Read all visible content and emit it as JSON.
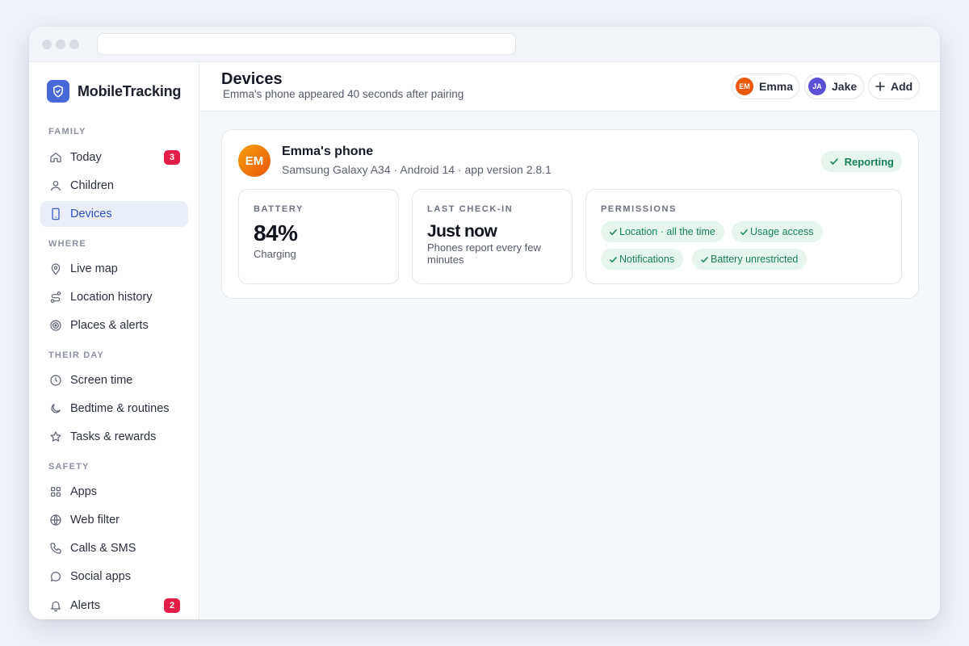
{
  "app": {
    "name": "MobileTracking",
    "accent": "#4668d9"
  },
  "sidebar": {
    "sections": [
      {
        "label": "FAMILY"
      },
      {
        "label": "WHERE"
      },
      {
        "label": "THEIR DAY"
      },
      {
        "label": "SAFETY"
      }
    ],
    "items": [
      {
        "label": "Today",
        "icon": "home-icon",
        "badge": "3"
      },
      {
        "label": "Children",
        "icon": "user-icon"
      },
      {
        "label": "Devices",
        "icon": "phone-icon",
        "active": true
      },
      {
        "label": "Live map",
        "icon": "map-pin-icon"
      },
      {
        "label": "Location history",
        "icon": "route-icon"
      },
      {
        "label": "Places & alerts",
        "icon": "target-icon"
      },
      {
        "label": "Screen time",
        "icon": "clock-icon"
      },
      {
        "label": "Bedtime & routines",
        "icon": "moon-icon"
      },
      {
        "label": "Tasks & rewards",
        "icon": "star-icon"
      },
      {
        "label": "Apps",
        "icon": "grid-icon"
      },
      {
        "label": "Web filter",
        "icon": "globe-icon"
      },
      {
        "label": "Calls & SMS",
        "icon": "phone-call-icon"
      },
      {
        "label": "Social apps",
        "icon": "chat-bubble-icon"
      },
      {
        "label": "Alerts",
        "icon": "bell-icon",
        "badge": "2"
      }
    ]
  },
  "header": {
    "title": "Devices",
    "subtitle": "Emma's phone appeared 40 seconds after pairing",
    "children": [
      {
        "initials": "EM",
        "name": "Emma",
        "color": "#ea580c"
      },
      {
        "initials": "JA",
        "name": "Jake",
        "color": "#5b4fd6"
      }
    ],
    "add_label": "Add"
  },
  "device": {
    "initials": "EM",
    "name": "Emma's phone",
    "meta": "Samsung Galaxy A34 · Android 14 · app version 2.8.1",
    "status": "Reporting",
    "battery": {
      "label": "BATTERY",
      "value": "84%",
      "note": "Charging"
    },
    "checkin": {
      "label": "LAST CHECK-IN",
      "value": "Just now",
      "note": "Phones report every few minutes"
    },
    "permissions": {
      "label": "PERMISSIONS",
      "items": [
        "Location · all the time",
        "Usage access",
        "Notifications",
        "Battery unrestricted"
      ]
    }
  }
}
